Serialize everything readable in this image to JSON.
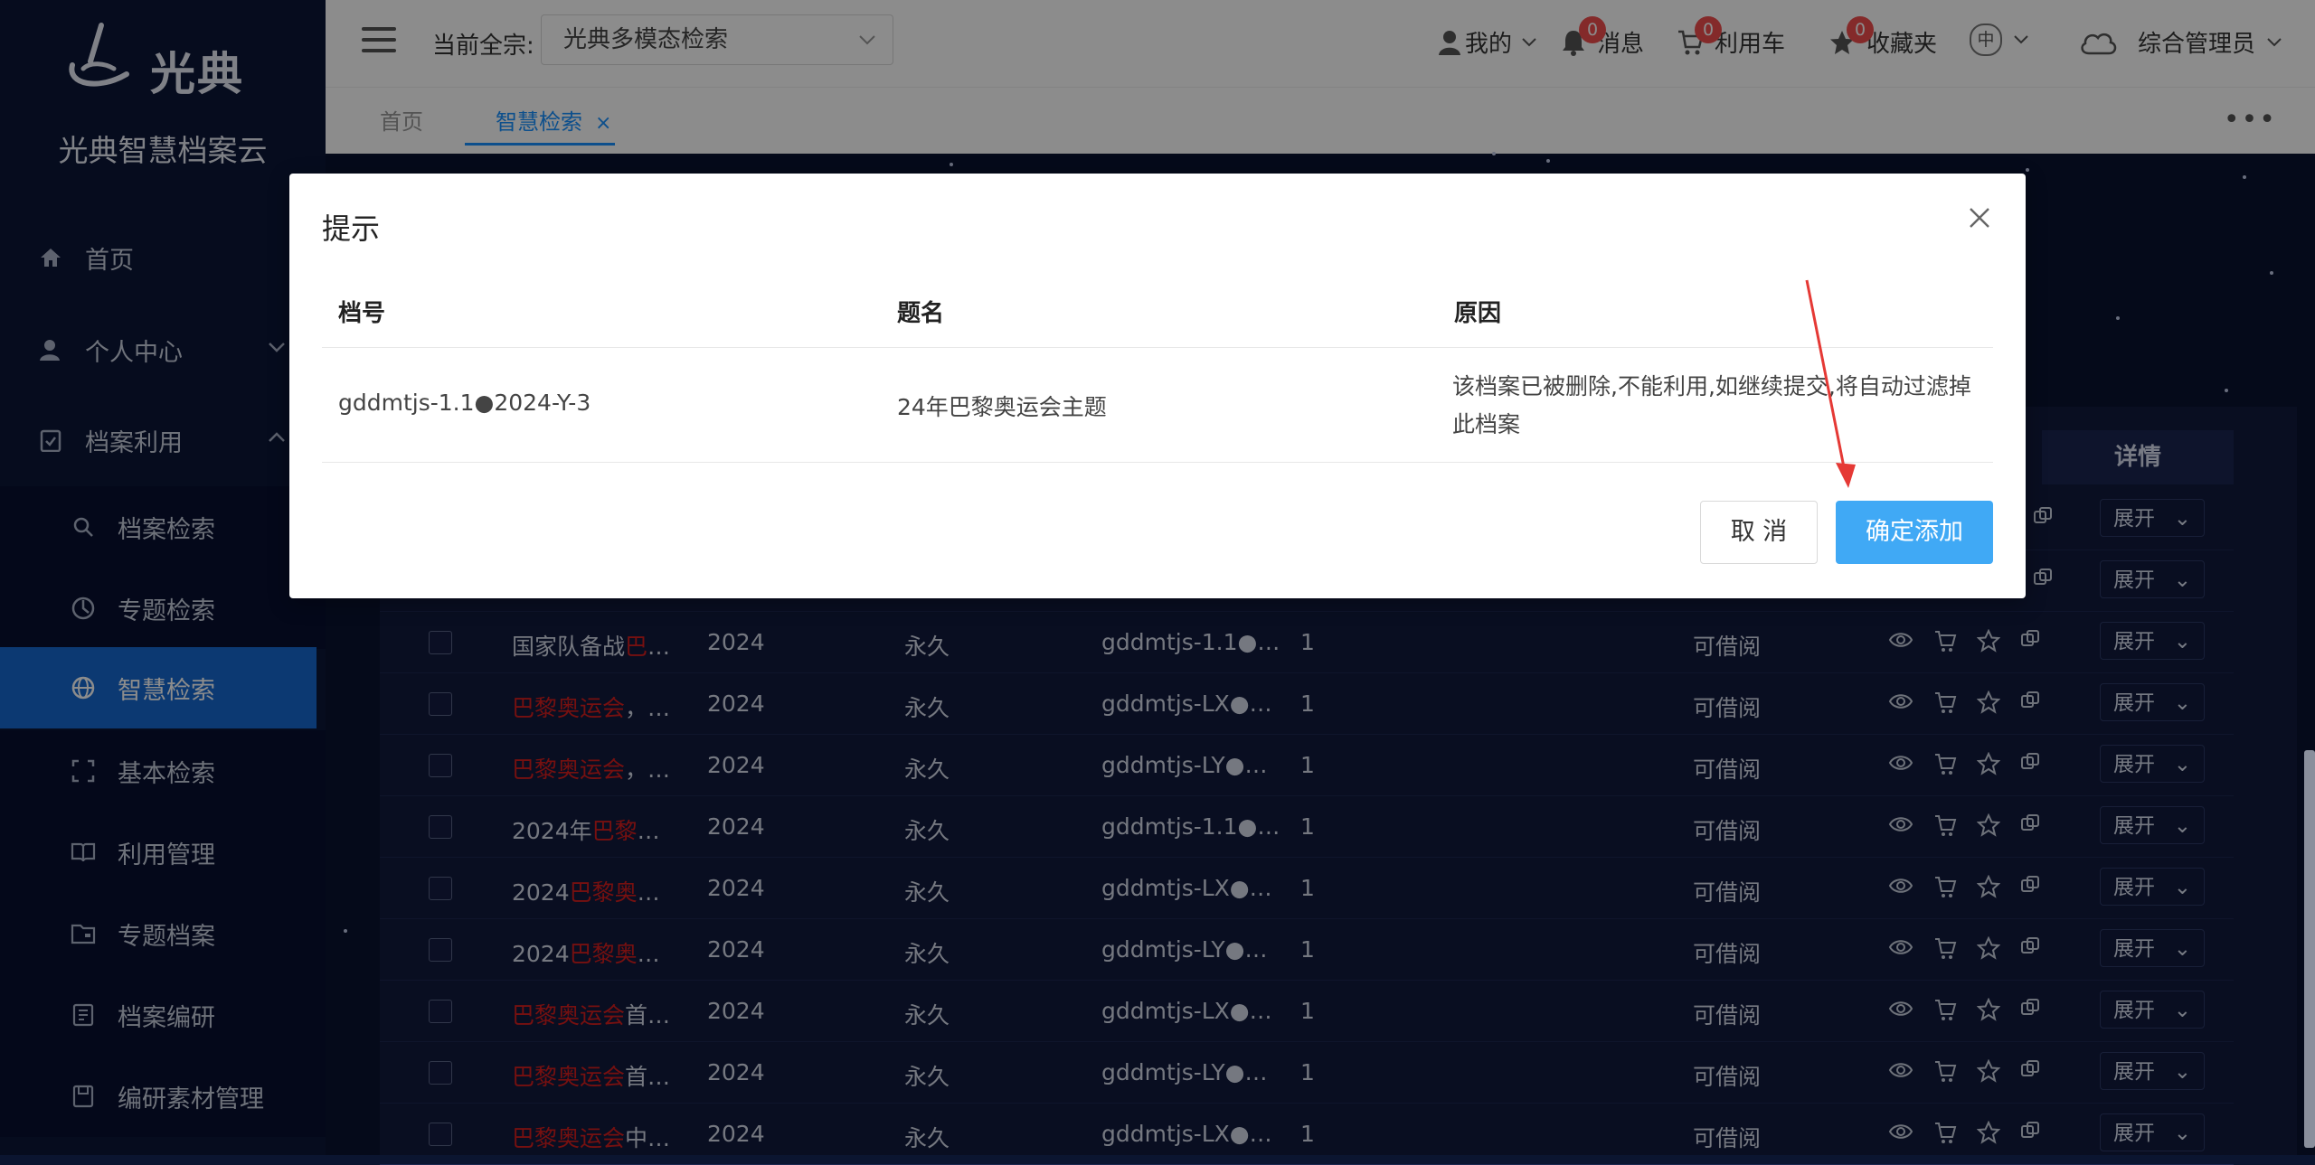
{
  "brand": {
    "logo_text": "光典",
    "app_name": "光典智慧档案云"
  },
  "nav": {
    "home": "首页",
    "personal": "个人中心",
    "archive_use": "档案利用",
    "sub": [
      "档案检索",
      "专题检索",
      "智慧检索",
      "基本检索",
      "利用管理",
      "专题档案",
      "档案编研",
      "编研素材管理"
    ]
  },
  "header": {
    "current_label": "当前全宗:",
    "quanzong_value": "光典多模态检索",
    "my": "我的",
    "messages": "消息",
    "messages_count": "0",
    "cart": "利用车",
    "cart_count": "0",
    "favorites": "收藏夹",
    "favorites_count": "0",
    "lang": "中",
    "user": "综合管理员"
  },
  "tabs": {
    "home": "首页",
    "active": "智慧检索",
    "close": "×",
    "more": "•••"
  },
  "table": {
    "detail_header": "详情",
    "rows": [
      {
        "title_pre": "国家队备战",
        "title_red": "巴",
        "title_post": "…",
        "year": "2024",
        "period": "永久",
        "code": "gddmtjs-1.1●…",
        "count": "1",
        "status": "可借阅",
        "action": "展开"
      },
      {
        "title_pre": "",
        "title_red": "巴黎奥运会",
        "title_post": "，…",
        "year": "2024",
        "period": "永久",
        "code": "gddmtjs-LX●…",
        "count": "1",
        "status": "可借阅",
        "action": "展开"
      },
      {
        "title_pre": "",
        "title_red": "巴黎奥运会",
        "title_post": "，…",
        "year": "2024",
        "period": "永久",
        "code": "gddmtjs-LY●…",
        "count": "1",
        "status": "可借阅",
        "action": "展开"
      },
      {
        "title_pre": "2024年",
        "title_red": "巴黎",
        "title_post": "…",
        "year": "2024",
        "period": "永久",
        "code": "gddmtjs-1.1●…",
        "count": "1",
        "status": "可借阅",
        "action": "展开"
      },
      {
        "title_pre": "2024",
        "title_red": "巴黎奥",
        "title_post": "…",
        "year": "2024",
        "period": "永久",
        "code": "gddmtjs-LX●…",
        "count": "1",
        "status": "可借阅",
        "action": "展开"
      },
      {
        "title_pre": "2024",
        "title_red": "巴黎奥",
        "title_post": "…",
        "year": "2024",
        "period": "永久",
        "code": "gddmtjs-LY●…",
        "count": "1",
        "status": "可借阅",
        "action": "展开"
      },
      {
        "title_pre": "",
        "title_red": "巴黎奥运会",
        "title_post": "首…",
        "year": "2024",
        "period": "永久",
        "code": "gddmtjs-LX●…",
        "count": "1",
        "status": "可借阅",
        "action": "展开"
      },
      {
        "title_pre": "",
        "title_red": "巴黎奥运会",
        "title_post": "首…",
        "year": "2024",
        "period": "永久",
        "code": "gddmtjs-LY●…",
        "count": "1",
        "status": "可借阅",
        "action": "展开"
      },
      {
        "title_pre": "",
        "title_red": "巴黎奥运会",
        "title_post": "中…",
        "year": "2024",
        "period": "永久",
        "code": "gddmtjs-LX●…",
        "count": "1",
        "status": "可借阅",
        "action": "展开"
      }
    ],
    "partial_actions": [
      "展开",
      "展开"
    ]
  },
  "modal": {
    "title": "提示",
    "columns": {
      "code": "档号",
      "name": "题名",
      "reason": "原因"
    },
    "row": {
      "code": "gddmtjs-1.1●2024-Y-3",
      "name": "24年巴黎奥运会主题",
      "reason": "该档案已被删除,不能利用,如继续提交,将自动过滤掉此档案"
    },
    "cancel": "取 消",
    "confirm": "确定添加"
  },
  "colors": {
    "primary": "#1890ff",
    "confirm": "#40a9f5",
    "sidebar": "#0c1638",
    "highlight": "#d81e1e",
    "annotation": "#e53935"
  }
}
